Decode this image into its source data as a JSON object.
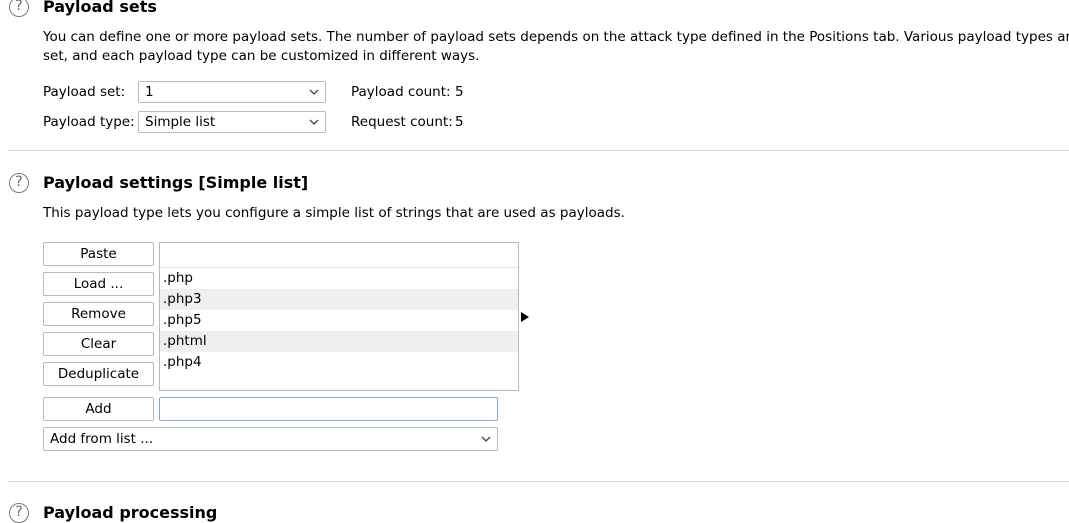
{
  "payload_sets": {
    "title": "Payload sets",
    "description_line1": "You can define one or more payload sets. The number of payload sets depends on the attack type defined in the Positions tab. Various payload types are av",
    "description_line2": "set, and each payload type can be customized in different ways.",
    "payload_set_label": "Payload set:",
    "payload_set_value": "1",
    "payload_type_label": "Payload type:",
    "payload_type_value": "Simple list",
    "payload_count_label": "Payload count:",
    "payload_count_value": "5",
    "request_count_label": "Request count:",
    "request_count_value": "5"
  },
  "payload_settings": {
    "title": "Payload settings [Simple list]",
    "description": "This payload type lets you configure a simple list of strings that are used as payloads.",
    "buttons": {
      "paste": "Paste",
      "load": "Load ...",
      "remove": "Remove",
      "clear": "Clear",
      "deduplicate": "Deduplicate",
      "add": "Add"
    },
    "items": [
      ".php",
      ".php3",
      ".php5",
      ".phtml",
      ".php4"
    ],
    "add_input_value": "",
    "add_from_list_label": "Add from list ..."
  },
  "payload_processing": {
    "title": "Payload processing"
  },
  "icons": {
    "help": "?",
    "help_icon_name": "help-icon",
    "chevron_icon_name": "chevron-down-icon",
    "arrow_icon_name": "triangle-right-icon"
  },
  "colors": {
    "focus_border": "#7fa9d6",
    "alt_row": "#efefef",
    "divider": "#d6d6d6"
  }
}
